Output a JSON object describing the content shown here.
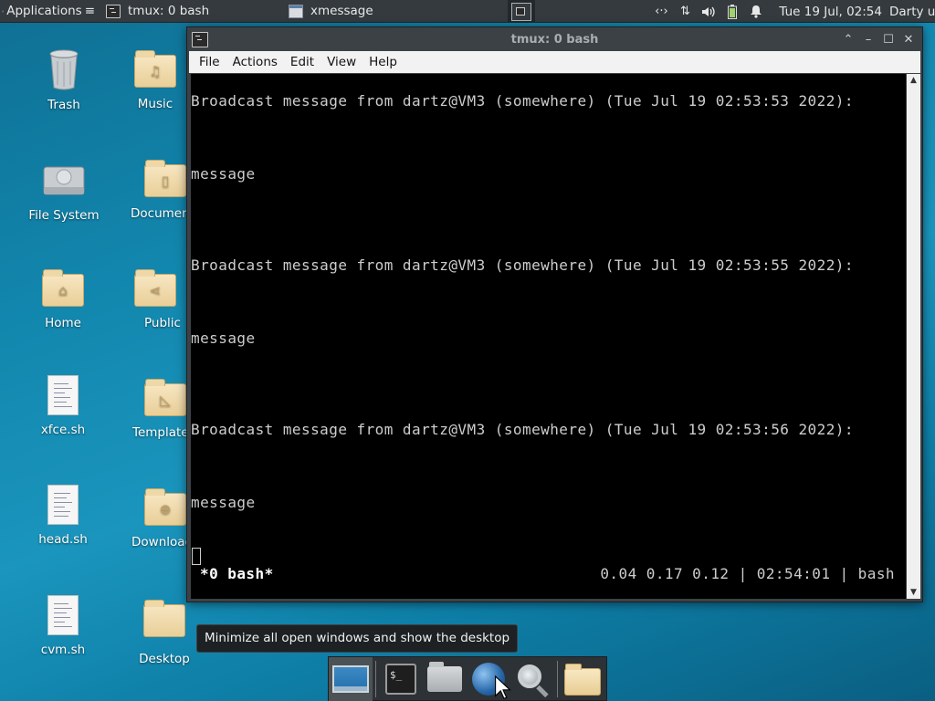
{
  "top_panel": {
    "applications_label": "Applications",
    "tasks": [
      {
        "label": "tmux: 0 bash",
        "icon": "terminal-icon"
      },
      {
        "label": "xmessage",
        "icon": "xmessage-window-icon"
      }
    ],
    "clock": "Tue 19 Jul, 02:54",
    "user": "Darty uwu"
  },
  "desktop_icons": [
    {
      "label": "Trash",
      "icon": "trash-icon"
    },
    {
      "label": "Music",
      "icon": "music-folder-icon"
    },
    {
      "label": "File System",
      "icon": "drive-icon"
    },
    {
      "label": "Documents",
      "icon": "documents-folder-icon"
    },
    {
      "label": "Home",
      "icon": "home-folder-icon"
    },
    {
      "label": "Public",
      "icon": "public-folder-icon"
    },
    {
      "label": "xfce.sh",
      "icon": "script-file-icon"
    },
    {
      "label": "Templates",
      "icon": "templates-folder-icon"
    },
    {
      "label": "head.sh",
      "icon": "script-file-icon"
    },
    {
      "label": "Downloads",
      "icon": "downloads-folder-icon"
    },
    {
      "label": "cvm.sh",
      "icon": "script-file-icon"
    },
    {
      "label": "Desktop",
      "icon": "folder-icon"
    }
  ],
  "window": {
    "title": "tmux: 0 bash",
    "menu": [
      "File",
      "Actions",
      "Edit",
      "View",
      "Help"
    ],
    "lines": [
      "Broadcast message from dartz@VM3 (somewhere) (Tue Jul 19 02:53:53 2022):",
      "message",
      "Broadcast message from dartz@VM3 (somewhere) (Tue Jul 19 02:53:55 2022):",
      "message",
      "Broadcast message from dartz@VM3 (somewhere) (Tue Jul 19 02:53:56 2022):",
      "message"
    ],
    "status_left": "*0 bash*",
    "status_right": "0.04 0.17 0.12 | 02:54:01 | bash"
  },
  "tooltip": "Minimize all open windows and show the desktop",
  "dock": [
    "show-desktop-icon",
    "terminal-icon",
    "home-folder-icon",
    "web-browser-icon",
    "search-icon",
    "file-manager-icon"
  ]
}
